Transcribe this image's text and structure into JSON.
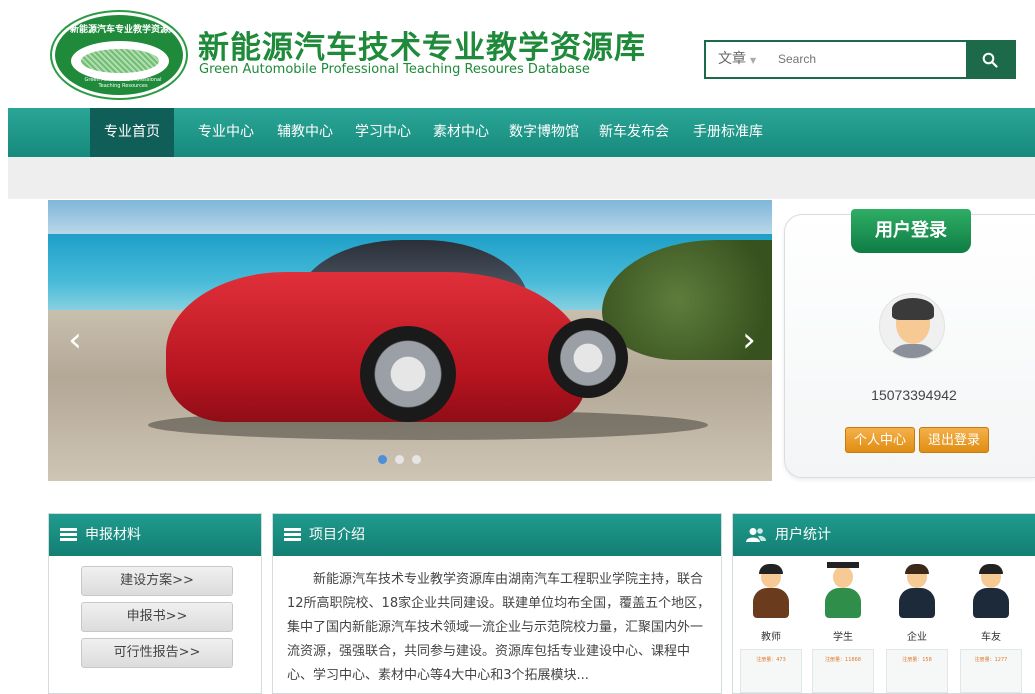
{
  "header": {
    "logo_ring_text": "新能源汽车专业教学资源库",
    "logo_sub_text": "Green Automobile Professional Teaching Resources",
    "title_cn": "新能源汽车技术专业教学资源库",
    "title_en": "Green Automobile Professional Teaching Resoures Database"
  },
  "search": {
    "category": "文章",
    "placeholder": "Search"
  },
  "nav": {
    "items": [
      "专业首页",
      "专业中心",
      "辅教中心",
      "学习中心",
      "素材中心",
      "数字博物馆",
      "新车发布会",
      "手册标准库"
    ],
    "active_index": 0
  },
  "banner": {
    "slide_count": 3,
    "active_slide": 0,
    "prev_arrow": "‹",
    "next_arrow": "›"
  },
  "login": {
    "title": "用户登录",
    "username": "15073394942",
    "personal_center": "个人中心",
    "logout": "退出登录"
  },
  "materials": {
    "title": "申报材料",
    "buttons": [
      "建设方案>>",
      "申报书>>",
      "可行性报告>>"
    ]
  },
  "intro": {
    "title": "项目介绍",
    "text": "新能源汽车技术专业教学资源库由湖南汽车工程职业学院主持，联合12所高职院校、18家企业共同建设。联建单位均布全国，覆盖五个地区，集中了国内新能源汽车技术领域一流企业与示范院校力量，汇聚国内外一流资源，强强联合，共同参与建设。资源库包括专业建设中心、课程中心、学习中心、素材中心等4大中心和3个拓展模块..."
  },
  "stats": {
    "title": "用户统计",
    "users": [
      {
        "label": "教师",
        "card": "注册量：473"
      },
      {
        "label": "学生",
        "card": "注册量：11868"
      },
      {
        "label": "企业",
        "card": "注册量：158"
      },
      {
        "label": "车友",
        "card": "注册量：1277"
      }
    ]
  },
  "colors": {
    "brand_green": "#1e8a3a",
    "nav_teal": "#1a9486",
    "nav_active": "#0f5e58",
    "button_orange": "#e9981c"
  }
}
